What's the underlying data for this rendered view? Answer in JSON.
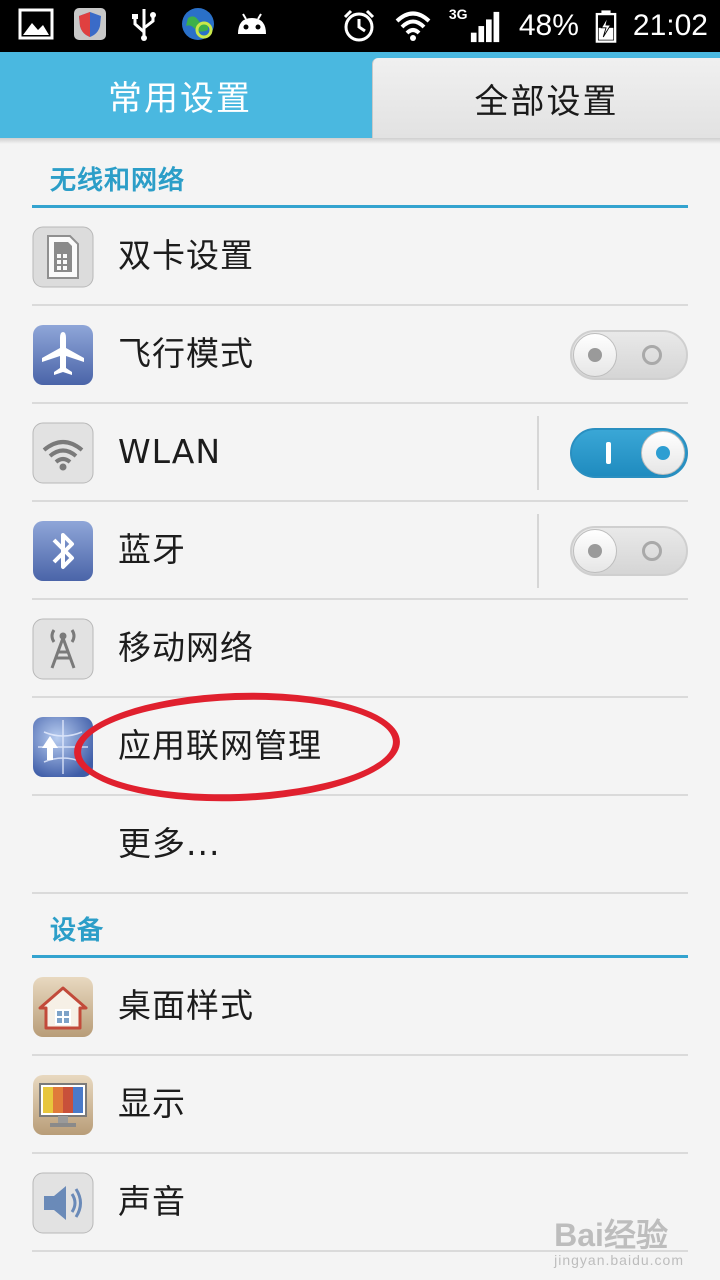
{
  "status_bar": {
    "signal_type": "3G",
    "battery": "48%",
    "time": "21:02",
    "icons": [
      "gallery-icon",
      "shield-icon",
      "usb-icon",
      "globe-sync-icon",
      "android-icon",
      "alarm-icon",
      "wifi-icon",
      "signal-icon",
      "battery-charging-icon"
    ]
  },
  "tabs": {
    "common": "常用设置",
    "all": "全部设置",
    "selected": "all"
  },
  "sections": {
    "wireless": {
      "title": "无线和网络",
      "items": [
        {
          "label": "双卡设置",
          "icon": "dual-sim-icon"
        },
        {
          "label": "飞行模式",
          "icon": "airplane-icon",
          "toggle": "off"
        },
        {
          "label": "WLAN",
          "icon": "wlan-icon",
          "toggle": "on"
        },
        {
          "label": "蓝牙",
          "icon": "bluetooth-icon",
          "toggle": "off"
        },
        {
          "label": "移动网络",
          "icon": "antenna-icon"
        },
        {
          "label": "应用联网管理",
          "icon": "app-network-icon"
        },
        {
          "label": "更多..."
        }
      ]
    },
    "device": {
      "title": "设备",
      "items": [
        {
          "label": "桌面样式",
          "icon": "home-icon"
        },
        {
          "label": "显示",
          "icon": "display-icon"
        },
        {
          "label": "声音",
          "icon": "speaker-icon"
        }
      ]
    }
  },
  "watermark": {
    "brand": "Bai经验",
    "url": "jingyan.baidu.com"
  },
  "colors": {
    "accent": "#33a3cf",
    "tab_bar": "#4ab8e0",
    "annotation": "#e0202e"
  }
}
